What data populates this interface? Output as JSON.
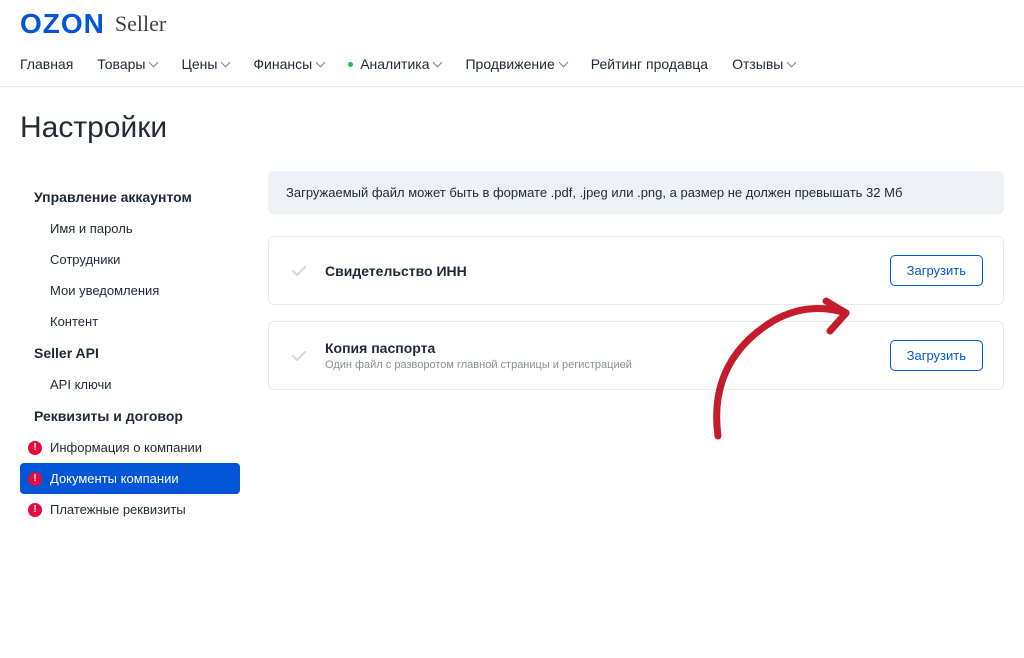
{
  "logo": {
    "ozon": "OZON",
    "seller": "Seller"
  },
  "nav": {
    "items": [
      {
        "label": "Главная",
        "has_chevron": false
      },
      {
        "label": "Товары",
        "has_chevron": true
      },
      {
        "label": "Цены",
        "has_chevron": true
      },
      {
        "label": "Финансы",
        "has_chevron": true
      },
      {
        "label": "Аналитика",
        "has_chevron": true,
        "has_dot": true
      },
      {
        "label": "Продвижение",
        "has_chevron": true
      },
      {
        "label": "Рейтинг продавца",
        "has_chevron": false
      },
      {
        "label": "Отзывы",
        "has_chevron": true
      }
    ]
  },
  "page_title": "Настройки",
  "sidebar": {
    "sections": [
      {
        "title": "Управление аккаунтом",
        "items": [
          {
            "label": "Имя и пароль"
          },
          {
            "label": "Сотрудники"
          },
          {
            "label": "Мои уведомления"
          },
          {
            "label": "Контент"
          }
        ]
      },
      {
        "title": "Seller API",
        "items": [
          {
            "label": "API ключи"
          }
        ]
      },
      {
        "title": "Реквизиты и договор",
        "items": [
          {
            "label": "Информация о компании",
            "alert": true
          },
          {
            "label": "Документы компании",
            "alert": true,
            "active": true
          },
          {
            "label": "Платежные реквизиты",
            "alert": true
          }
        ]
      }
    ]
  },
  "main": {
    "banner": "Загружаемый файл может быть в формате .pdf, .jpeg или .png, а размер не должен превышать 32 Мб",
    "documents": [
      {
        "title": "Свидетельство ИНН",
        "subtitle": "",
        "upload_label": "Загрузить"
      },
      {
        "title": "Копия паспорта",
        "subtitle": "Один файл с разворотом главной страницы и регистрацией",
        "upload_label": "Загрузить"
      }
    ]
  }
}
